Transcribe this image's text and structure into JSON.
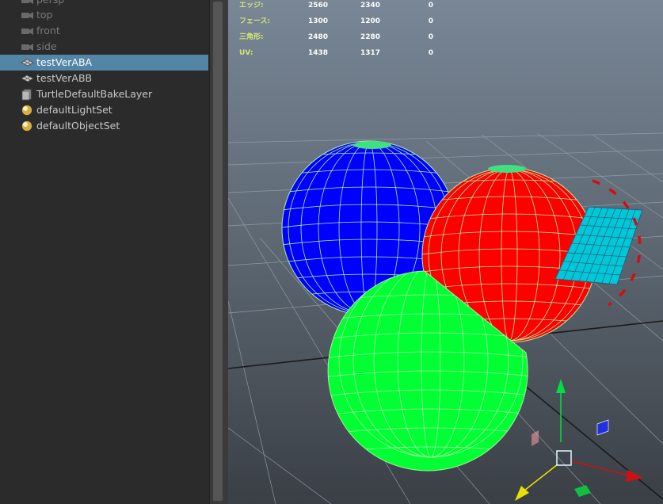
{
  "outliner": {
    "items": [
      {
        "label": "persp",
        "icon": "camera-icon",
        "dim": true,
        "selected": false
      },
      {
        "label": "top",
        "icon": "camera-icon",
        "dim": true,
        "selected": false
      },
      {
        "label": "front",
        "icon": "camera-icon",
        "dim": true,
        "selected": false
      },
      {
        "label": "side",
        "icon": "camera-icon",
        "dim": true,
        "selected": false
      },
      {
        "label": "testVerABA",
        "icon": "mesh-transform-icon",
        "dim": false,
        "selected": true
      },
      {
        "label": "testVerABB",
        "icon": "mesh-transform-icon",
        "dim": false,
        "selected": false
      },
      {
        "label": "TurtleDefaultBakeLayer",
        "icon": "bake-layer-icon",
        "dim": false,
        "selected": false
      },
      {
        "label": "defaultLightSet",
        "icon": "set-icon",
        "dim": false,
        "selected": false
      },
      {
        "label": "defaultObjectSet",
        "icon": "set-icon",
        "dim": false,
        "selected": false
      }
    ]
  },
  "hud": {
    "rows": [
      {
        "label": "エッジ:",
        "values": [
          "2560",
          "2340",
          "0"
        ]
      },
      {
        "label": "フェース:",
        "values": [
          "1300",
          "1200",
          "0"
        ]
      },
      {
        "label": "三角形:",
        "values": [
          "2480",
          "2280",
          "0"
        ]
      },
      {
        "label": "UV:",
        "values": [
          "1438",
          "1317",
          "0"
        ]
      }
    ]
  },
  "colors": {
    "selection": "#5285a6",
    "sphere_blue": "#0000ff",
    "sphere_red": "#ff0000",
    "sphere_green": "#00ff33",
    "wire": "#a8f0a0",
    "plane": "#00c8d8"
  }
}
